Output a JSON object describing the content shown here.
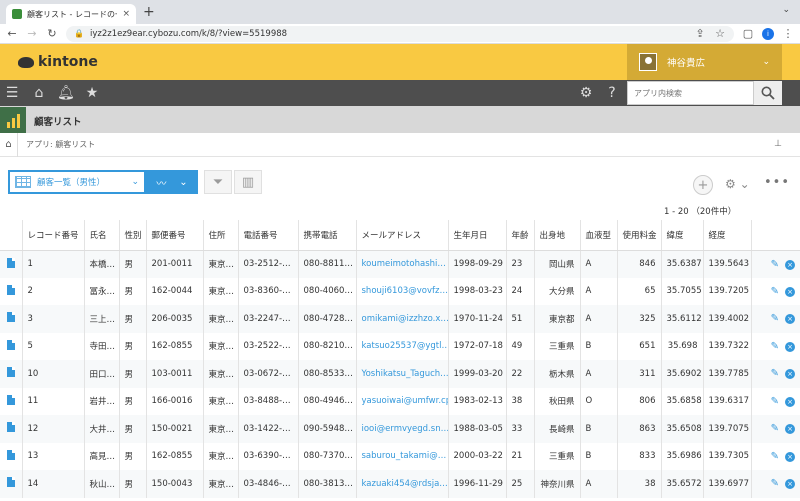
{
  "browser": {
    "tab_title": "顧客リスト - レコードの一覧",
    "tab_close": "×",
    "new_tab": "+",
    "url": "iyz2z1ez9ear.cybozu.com/k/8/?view=5519988",
    "profile_initial": "i"
  },
  "header": {
    "logo_text": "kintone",
    "user_name": "神谷貴広"
  },
  "toolbar": {
    "search_placeholder": "アプリ内検索"
  },
  "app": {
    "title": "顧客リスト",
    "breadcrumb": "アプリ: 顧客リスト"
  },
  "view": {
    "selected_view": "顧客一覧（男性）",
    "pager": "1 - 20 （20件中）"
  },
  "table": {
    "columns": [
      "",
      "レコード番号",
      "氏名",
      "性別",
      "郵便番号",
      "住所",
      "電話番号",
      "携帯電話",
      "メールアドレス",
      "生年月日",
      "年齢",
      "出身地",
      "血液型",
      "使用料金",
      "緯度",
      "経度",
      ""
    ],
    "rows": [
      [
        "1",
        "本橋…",
        "男",
        "201-0011",
        "東京…",
        "03-2512-…",
        "080-8811…",
        "koumeimotohashi…",
        "1998-09-29",
        "23",
        "岡山県",
        "A",
        "846",
        "35.6387",
        "139.5643"
      ],
      [
        "2",
        "冨永…",
        "男",
        "162-0044",
        "東京…",
        "03-8360-…",
        "080-4060…",
        "shouji6103@vovfz…",
        "1998-03-23",
        "24",
        "大分県",
        "A",
        "65",
        "35.7055",
        "139.7205"
      ],
      [
        "3",
        "三上…",
        "男",
        "206-0035",
        "東京…",
        "03-2247-…",
        "080-4728…",
        "omikami@izzhzo.x…",
        "1970-11-24",
        "51",
        "東京都",
        "A",
        "325",
        "35.6112",
        "139.4002"
      ],
      [
        "5",
        "寺田…",
        "男",
        "162-0855",
        "東京…",
        "03-2522-…",
        "080-8210…",
        "katsuo25537@ygtl…",
        "1972-07-18",
        "49",
        "三重県",
        "B",
        "651",
        "35.698",
        "139.7322"
      ],
      [
        "10",
        "田口…",
        "男",
        "103-0011",
        "東京…",
        "03-0672-…",
        "080-8533…",
        "Yoshikatsu_Taguch…",
        "1999-03-20",
        "22",
        "栃木県",
        "A",
        "311",
        "35.6902",
        "139.7785"
      ],
      [
        "11",
        "岩井…",
        "男",
        "166-0016",
        "東京…",
        "03-8488-…",
        "080-4946…",
        "yasuoiwai@umfwr.cp",
        "1983-02-13",
        "38",
        "秋田県",
        "O",
        "806",
        "35.6858",
        "139.6317"
      ],
      [
        "12",
        "大井…",
        "男",
        "150-0021",
        "東京…",
        "03-1422-…",
        "090-5948…",
        "iooi@ermvyegd.sn…",
        "1988-03-05",
        "33",
        "長崎県",
        "B",
        "863",
        "35.6508",
        "139.7075"
      ],
      [
        "13",
        "高見…",
        "男",
        "162-0855",
        "東京…",
        "03-6390-…",
        "080-7370…",
        "saburou_takami@…",
        "2000-03-22",
        "21",
        "三重県",
        "B",
        "833",
        "35.6986",
        "139.7305"
      ],
      [
        "14",
        "秋山…",
        "男",
        "150-0043",
        "東京…",
        "03-4846-…",
        "080-3813…",
        "kazuaki454@rdsja…",
        "1996-11-29",
        "25",
        "神奈川県",
        "A",
        "38",
        "35.6572",
        "139.6977"
      ]
    ]
  },
  "colors": {
    "header_yellow": "#f9c942",
    "accent_blue": "#3498db",
    "dark_bar": "#4e4e4e"
  }
}
